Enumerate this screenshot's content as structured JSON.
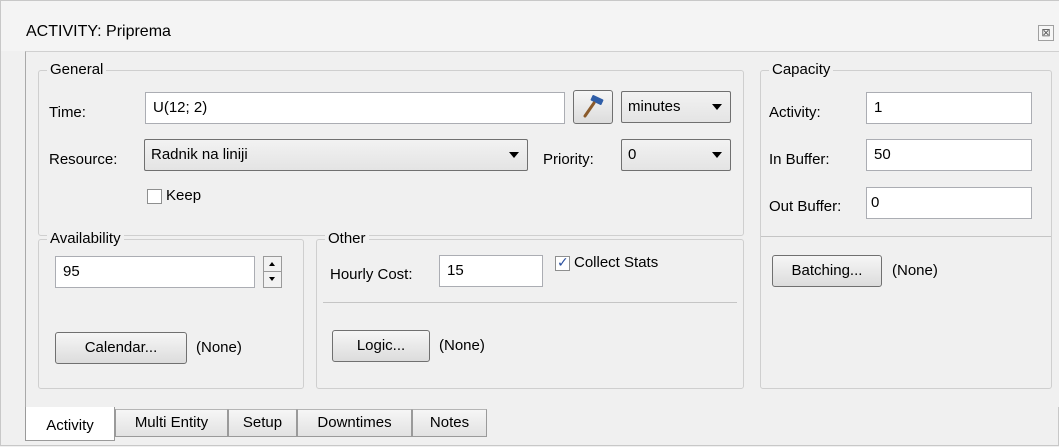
{
  "window": {
    "title": "ACTIVITY: Priprema",
    "close_glyph": "⊠"
  },
  "general": {
    "legend": "General",
    "time_label": "Time:",
    "time_value": "U(12; 2)",
    "time_unit": "minutes",
    "resource_label": "Resource:",
    "resource_value": "Radnik na liniji",
    "priority_label": "Priority:",
    "priority_value": "0",
    "keep_label": "Keep",
    "keep_checked": false
  },
  "availability": {
    "legend": "Availability",
    "value": "95",
    "calendar_button": "Calendar...",
    "calendar_status": "(None)"
  },
  "other": {
    "legend": "Other",
    "hourly_cost_label": "Hourly Cost:",
    "hourly_cost_value": "15",
    "collect_stats_label": "Collect Stats",
    "collect_stats_checked": true,
    "logic_button": "Logic...",
    "logic_status": "(None)"
  },
  "capacity": {
    "legend": "Capacity",
    "activity_label": "Activity:",
    "activity_value": "1",
    "in_buffer_label": "In Buffer:",
    "in_buffer_value": "50",
    "out_buffer_label": "Out Buffer:",
    "out_buffer_value": "0",
    "batching_button": "Batching...",
    "batching_status": "(None)"
  },
  "tabs": [
    {
      "label": "Activity",
      "active": true
    },
    {
      "label": "Multi Entity",
      "active": false
    },
    {
      "label": "Setup",
      "active": false
    },
    {
      "label": "Downtimes",
      "active": false
    },
    {
      "label": "Notes",
      "active": false
    }
  ]
}
